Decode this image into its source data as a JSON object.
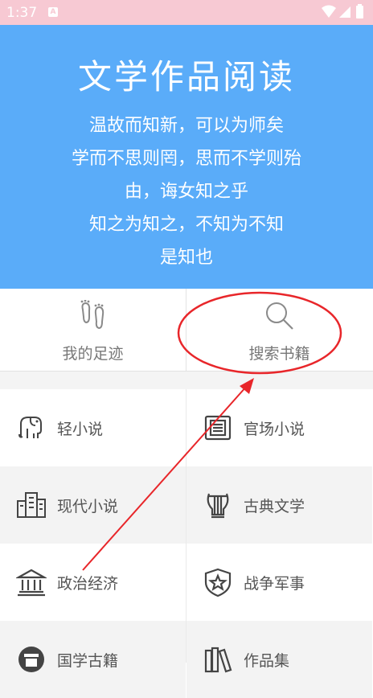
{
  "status": {
    "time": "1:37",
    "notification": "A"
  },
  "header": {
    "title": "文学作品阅读",
    "lines": [
      "温故而知新，可以为师矣",
      "学而不思则罔，思而不学则殆",
      "由，诲女知之乎",
      "知之为知之，不知为不知",
      "是知也"
    ],
    "background": "#5aacf9"
  },
  "quick_actions": [
    {
      "label": "我的足迹",
      "icon": "footprints-icon"
    },
    {
      "label": "搜索书籍",
      "icon": "search-icon"
    }
  ],
  "categories": [
    {
      "label": "轻小说",
      "icon": "elephant-icon"
    },
    {
      "label": "官场小说",
      "icon": "document-frame-icon"
    },
    {
      "label": "现代小说",
      "icon": "buildings-icon"
    },
    {
      "label": "古典文学",
      "icon": "lyre-icon"
    },
    {
      "label": "政治经济",
      "icon": "government-building-icon"
    },
    {
      "label": "战争军事",
      "icon": "star-shield-icon"
    },
    {
      "label": "国学古籍",
      "icon": "scholar-icon"
    },
    {
      "label": "作品集",
      "icon": "books-icon"
    }
  ],
  "annotation_color": "#e8262a"
}
